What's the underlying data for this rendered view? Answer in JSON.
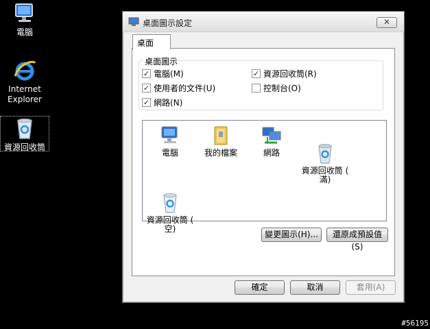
{
  "desktop": {
    "icons": [
      {
        "label": "電腦",
        "icon": "computer-icon"
      },
      {
        "label": "Internet\nExplorer",
        "icon": "ie-icon"
      },
      {
        "label": "資源回收筒",
        "icon": "recycle-bin-icon"
      }
    ],
    "watermark": "#56195"
  },
  "dialog": {
    "title": "桌面圖示設定",
    "close_label": "✕",
    "tab_label": "桌面",
    "group_label": "桌面圖示",
    "checkboxes": [
      {
        "label": "電腦(M)",
        "checked": true
      },
      {
        "label": "使用者的文件(U)",
        "checked": true
      },
      {
        "label": "網路(N)",
        "checked": true
      },
      {
        "label": "資源回收筒(R)",
        "checked": true
      },
      {
        "label": "控制台(O)",
        "checked": false
      }
    ],
    "icon_list": [
      {
        "label": "電腦",
        "icon": "computer-icon"
      },
      {
        "label": "我的檔案",
        "icon": "folder-icon"
      },
      {
        "label": "網路",
        "icon": "network-icon"
      },
      {
        "label": "資源回收筒 (\n滿)",
        "icon": "recycle-bin-full-icon"
      },
      {
        "label": "資源回收筒 (\n空)",
        "icon": "recycle-bin-empty-icon"
      }
    ],
    "buttons": {
      "change_icon": "變更圖示(H)...",
      "restore_default": "還原成預設值(S)",
      "ok": "確定",
      "cancel": "取消",
      "apply": "套用(A)"
    }
  }
}
